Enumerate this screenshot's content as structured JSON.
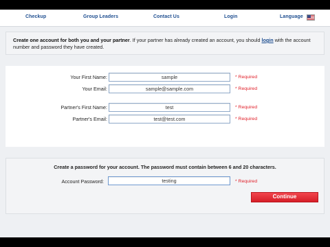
{
  "nav": {
    "items": [
      "Checkup",
      "Group Leaders",
      "Contact Us",
      "Login",
      "Language"
    ],
    "language_icon": "us-flag-icon"
  },
  "intro": {
    "bold": "Create one account for both you and your partner",
    "text1": ".  If your partner has already created an account, you should",
    "link": "login",
    "text2": " with the account number and password they have created."
  },
  "form": {
    "fields": [
      {
        "label": "Your First Name:",
        "value": "sample",
        "required": "* Required"
      },
      {
        "label": "Your Email:",
        "value": "sample@sample.com",
        "required": "* Required"
      },
      {
        "label": "Partner's First Name:",
        "value": "test",
        "required": "* Required"
      },
      {
        "label": "Partner's Email:",
        "value": "test@test.com",
        "required": "* Required"
      }
    ]
  },
  "password": {
    "title": "Create a password for your account.  The password must contain between 6 and 20 characters.",
    "label": "Account Password:",
    "value": "testing",
    "required": "* Required",
    "continue_label": "Continue"
  },
  "colors": {
    "nav_text": "#1d4d8f",
    "required": "#e0202a",
    "button": "#e0262e"
  }
}
